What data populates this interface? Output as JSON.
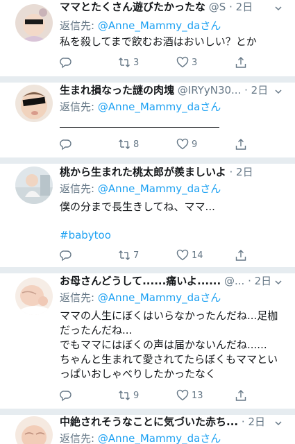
{
  "tweets": [
    {
      "name": "ママとたくさん遊びたかったな",
      "handle": "@S",
      "time": "2日",
      "reply_prefix": "返信先: ",
      "reply_mention": "@Anne_Mammy_da",
      "reply_suffix": "さん",
      "text": "私を殺してまで飲むお酒はおいしい？とか",
      "retweets": "3",
      "likes": "3"
    },
    {
      "name": "生まれ損なった謎の肉塊",
      "handle": "@IRYyN30...",
      "time": "2日",
      "reply_prefix": "返信先: ",
      "reply_mention": "@Anne_Mammy_da",
      "reply_suffix": "さん",
      "text": "",
      "retweets": "8",
      "likes": "9"
    },
    {
      "name": "桃から生まれた桃太郎が羨ましいよ",
      "handle": "",
      "time": "2日",
      "reply_prefix": "返信先: ",
      "reply_mention": "@Anne_Mammy_da",
      "reply_suffix": "さん",
      "text": "僕の分まで長生きしてね、ママ...",
      "hashtag": "#babytoo",
      "retweets": "7",
      "likes": "14"
    },
    {
      "name": "お母さんどうして......痛いよ......",
      "handle": "@...",
      "time": "2日",
      "reply_prefix": "返信先: ",
      "reply_mention": "@Anne_Mammy_da",
      "reply_suffix": "さん",
      "text": "ママの人生にぼくはいらなかったんだね...足枷だったんだね...\nでもママにはぼくの声は届かないんだね......\nちゃんと生まれて愛されてたらぼくもママといっぱいおしゃべりしたかったなく",
      "retweets": "9",
      "likes": "13"
    },
    {
      "name": "中絶されそうなことに気づいた赤ち...",
      "handle": "",
      "time": "2日",
      "reply_prefix": "返信先: ",
      "reply_mention": "@Anne_Mammy_da",
      "reply_suffix": "さん"
    }
  ],
  "icons": [
    "reply-icon",
    "retweet-icon",
    "like-icon",
    "share-icon",
    "chevron-down-icon"
  ],
  "colors": {
    "link": "#1da1f2",
    "secondary_text": "#657786",
    "primary_text": "#14171a",
    "separator": "#e6ecf0"
  }
}
